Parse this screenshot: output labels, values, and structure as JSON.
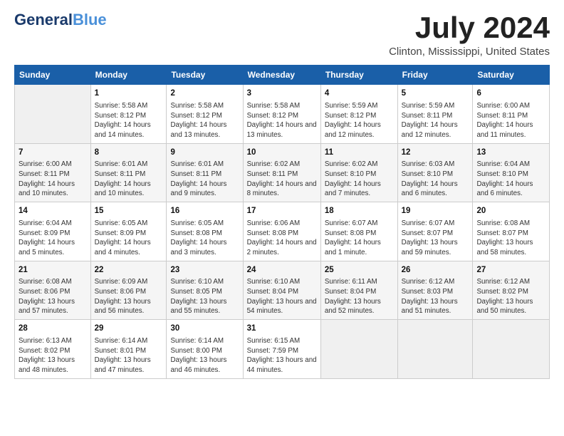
{
  "header": {
    "logo_line1": "General",
    "logo_line1_span": "Blue",
    "month": "July 2024",
    "location": "Clinton, Mississippi, United States"
  },
  "days_of_week": [
    "Sunday",
    "Monday",
    "Tuesday",
    "Wednesday",
    "Thursday",
    "Friday",
    "Saturday"
  ],
  "weeks": [
    [
      {
        "day": "",
        "empty": true
      },
      {
        "day": "1",
        "sunrise": "5:58 AM",
        "sunset": "8:12 PM",
        "daylight": "14 hours and 14 minutes."
      },
      {
        "day": "2",
        "sunrise": "5:58 AM",
        "sunset": "8:12 PM",
        "daylight": "14 hours and 13 minutes."
      },
      {
        "day": "3",
        "sunrise": "5:58 AM",
        "sunset": "8:12 PM",
        "daylight": "14 hours and 13 minutes."
      },
      {
        "day": "4",
        "sunrise": "5:59 AM",
        "sunset": "8:12 PM",
        "daylight": "14 hours and 12 minutes."
      },
      {
        "day": "5",
        "sunrise": "5:59 AM",
        "sunset": "8:11 PM",
        "daylight": "14 hours and 12 minutes."
      },
      {
        "day": "6",
        "sunrise": "6:00 AM",
        "sunset": "8:11 PM",
        "daylight": "14 hours and 11 minutes."
      }
    ],
    [
      {
        "day": "7",
        "sunrise": "6:00 AM",
        "sunset": "8:11 PM",
        "daylight": "14 hours and 10 minutes."
      },
      {
        "day": "8",
        "sunrise": "6:01 AM",
        "sunset": "8:11 PM",
        "daylight": "14 hours and 10 minutes."
      },
      {
        "day": "9",
        "sunrise": "6:01 AM",
        "sunset": "8:11 PM",
        "daylight": "14 hours and 9 minutes."
      },
      {
        "day": "10",
        "sunrise": "6:02 AM",
        "sunset": "8:11 PM",
        "daylight": "14 hours and 8 minutes."
      },
      {
        "day": "11",
        "sunrise": "6:02 AM",
        "sunset": "8:10 PM",
        "daylight": "14 hours and 7 minutes."
      },
      {
        "day": "12",
        "sunrise": "6:03 AM",
        "sunset": "8:10 PM",
        "daylight": "14 hours and 6 minutes."
      },
      {
        "day": "13",
        "sunrise": "6:04 AM",
        "sunset": "8:10 PM",
        "daylight": "14 hours and 6 minutes."
      }
    ],
    [
      {
        "day": "14",
        "sunrise": "6:04 AM",
        "sunset": "8:09 PM",
        "daylight": "14 hours and 5 minutes."
      },
      {
        "day": "15",
        "sunrise": "6:05 AM",
        "sunset": "8:09 PM",
        "daylight": "14 hours and 4 minutes."
      },
      {
        "day": "16",
        "sunrise": "6:05 AM",
        "sunset": "8:08 PM",
        "daylight": "14 hours and 3 minutes."
      },
      {
        "day": "17",
        "sunrise": "6:06 AM",
        "sunset": "8:08 PM",
        "daylight": "14 hours and 2 minutes."
      },
      {
        "day": "18",
        "sunrise": "6:07 AM",
        "sunset": "8:08 PM",
        "daylight": "14 hours and 1 minute."
      },
      {
        "day": "19",
        "sunrise": "6:07 AM",
        "sunset": "8:07 PM",
        "daylight": "13 hours and 59 minutes."
      },
      {
        "day": "20",
        "sunrise": "6:08 AM",
        "sunset": "8:07 PM",
        "daylight": "13 hours and 58 minutes."
      }
    ],
    [
      {
        "day": "21",
        "sunrise": "6:08 AM",
        "sunset": "8:06 PM",
        "daylight": "13 hours and 57 minutes."
      },
      {
        "day": "22",
        "sunrise": "6:09 AM",
        "sunset": "8:06 PM",
        "daylight": "13 hours and 56 minutes."
      },
      {
        "day": "23",
        "sunrise": "6:10 AM",
        "sunset": "8:05 PM",
        "daylight": "13 hours and 55 minutes."
      },
      {
        "day": "24",
        "sunrise": "6:10 AM",
        "sunset": "8:04 PM",
        "daylight": "13 hours and 54 minutes."
      },
      {
        "day": "25",
        "sunrise": "6:11 AM",
        "sunset": "8:04 PM",
        "daylight": "13 hours and 52 minutes."
      },
      {
        "day": "26",
        "sunrise": "6:12 AM",
        "sunset": "8:03 PM",
        "daylight": "13 hours and 51 minutes."
      },
      {
        "day": "27",
        "sunrise": "6:12 AM",
        "sunset": "8:02 PM",
        "daylight": "13 hours and 50 minutes."
      }
    ],
    [
      {
        "day": "28",
        "sunrise": "6:13 AM",
        "sunset": "8:02 PM",
        "daylight": "13 hours and 48 minutes."
      },
      {
        "day": "29",
        "sunrise": "6:14 AM",
        "sunset": "8:01 PM",
        "daylight": "13 hours and 47 minutes."
      },
      {
        "day": "30",
        "sunrise": "6:14 AM",
        "sunset": "8:00 PM",
        "daylight": "13 hours and 46 minutes."
      },
      {
        "day": "31",
        "sunrise": "6:15 AM",
        "sunset": "7:59 PM",
        "daylight": "13 hours and 44 minutes."
      },
      {
        "day": "",
        "empty": true
      },
      {
        "day": "",
        "empty": true
      },
      {
        "day": "",
        "empty": true
      }
    ]
  ]
}
